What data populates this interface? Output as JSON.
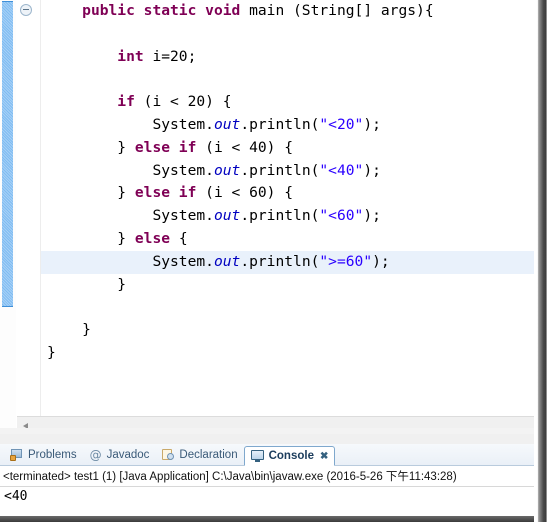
{
  "editor": {
    "fold_toggle_label": "collapse",
    "marker_bar_name": "method-range-marker",
    "code_lines": [
      {
        "indent": 1,
        "highlight": false,
        "tokens": [
          {
            "t": "kw",
            "v": "public static void "
          },
          {
            "t": "plain",
            "v": "main (String[] args){"
          }
        ]
      },
      {
        "indent": 0,
        "highlight": false,
        "tokens": []
      },
      {
        "indent": 2,
        "highlight": false,
        "tokens": [
          {
            "t": "kw",
            "v": "int"
          },
          {
            "t": "plain",
            "v": " i=20;"
          }
        ]
      },
      {
        "indent": 0,
        "highlight": false,
        "tokens": []
      },
      {
        "indent": 2,
        "highlight": false,
        "tokens": [
          {
            "t": "kw",
            "v": "if"
          },
          {
            "t": "plain",
            "v": " (i < 20) {"
          }
        ]
      },
      {
        "indent": 3,
        "highlight": false,
        "tokens": [
          {
            "t": "plain",
            "v": "System."
          },
          {
            "t": "fld",
            "v": "out"
          },
          {
            "t": "plain",
            "v": ".println("
          },
          {
            "t": "str",
            "v": "\"<20\""
          },
          {
            "t": "plain",
            "v": ");"
          }
        ]
      },
      {
        "indent": 2,
        "highlight": false,
        "tokens": [
          {
            "t": "plain",
            "v": "} "
          },
          {
            "t": "kw",
            "v": "else if"
          },
          {
            "t": "plain",
            "v": " (i < 40) {"
          }
        ]
      },
      {
        "indent": 3,
        "highlight": false,
        "tokens": [
          {
            "t": "plain",
            "v": "System."
          },
          {
            "t": "fld",
            "v": "out"
          },
          {
            "t": "plain",
            "v": ".println("
          },
          {
            "t": "str",
            "v": "\"<40\""
          },
          {
            "t": "plain",
            "v": ");"
          }
        ]
      },
      {
        "indent": 2,
        "highlight": false,
        "tokens": [
          {
            "t": "plain",
            "v": "} "
          },
          {
            "t": "kw",
            "v": "else if"
          },
          {
            "t": "plain",
            "v": " (i < 60) {"
          }
        ]
      },
      {
        "indent": 3,
        "highlight": false,
        "tokens": [
          {
            "t": "plain",
            "v": "System."
          },
          {
            "t": "fld",
            "v": "out"
          },
          {
            "t": "plain",
            "v": ".println("
          },
          {
            "t": "str",
            "v": "\"<60\""
          },
          {
            "t": "plain",
            "v": ");"
          }
        ]
      },
      {
        "indent": 2,
        "highlight": false,
        "tokens": [
          {
            "t": "plain",
            "v": "} "
          },
          {
            "t": "kw",
            "v": "else"
          },
          {
            "t": "plain",
            "v": " {"
          }
        ]
      },
      {
        "indent": 3,
        "highlight": true,
        "tokens": [
          {
            "t": "plain",
            "v": "System."
          },
          {
            "t": "fld",
            "v": "out"
          },
          {
            "t": "plain",
            "v": ".println("
          },
          {
            "t": "str",
            "v": "\">=60\""
          },
          {
            "t": "plain",
            "v": ");"
          }
        ]
      },
      {
        "indent": 2,
        "highlight": false,
        "tokens": [
          {
            "t": "plain",
            "v": "}"
          }
        ]
      },
      {
        "indent": 0,
        "highlight": false,
        "tokens": []
      },
      {
        "indent": 1,
        "highlight": false,
        "tokens": [
          {
            "t": "plain",
            "v": "}"
          }
        ]
      },
      {
        "indent": 0,
        "highlight": false,
        "tokens": [
          {
            "t": "plain",
            "v": "}"
          }
        ]
      }
    ],
    "colors": {
      "keyword": "#7f0055",
      "string": "#2a00ff",
      "field": "#0000c0",
      "plain": "#000000",
      "current_line_highlight": "#e9f1fb",
      "marker_blue": "#7fbcf2"
    },
    "scrollbar": {
      "left_arrow_icon": "triangle-left-icon"
    }
  },
  "console_view": {
    "tabs": [
      {
        "label": "Problems",
        "icon": "problems-icon",
        "active": false,
        "closable": false
      },
      {
        "label": "Javadoc",
        "icon": "javadoc-icon",
        "active": false,
        "closable": false,
        "glyph": "@"
      },
      {
        "label": "Declaration",
        "icon": "declaration-icon",
        "active": false,
        "closable": false
      },
      {
        "label": "Console",
        "icon": "console-icon",
        "active": true,
        "closable": true,
        "close_glyph": "✖"
      }
    ],
    "launch_line": "<terminated> test1 (1) [Java Application] C:\\Java\\bin\\javaw.exe (2016-5-26 下午11:43:28)",
    "output": "<40"
  }
}
